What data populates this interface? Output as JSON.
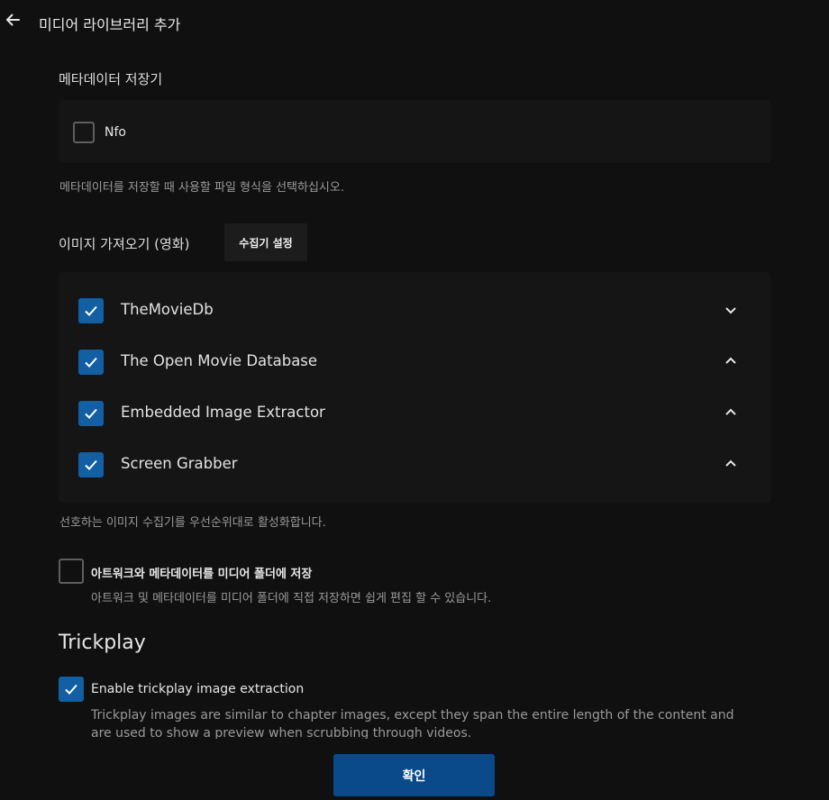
{
  "header": {
    "title": "미디어 라이브러리 추가",
    "back_icon": "arrow-left-icon"
  },
  "metadata_savers": {
    "label": "메타데이터 저장기",
    "items": [
      {
        "label": "Nfo",
        "checked": false
      }
    ],
    "help": "메타데이터를 저장할 때 사용할 파일 형식을 선택하십시오."
  },
  "image_fetchers": {
    "label": "이미지 가져오기 (영화)",
    "settings_button": "수집기 설정",
    "items": [
      {
        "label": "TheMovieDb",
        "checked": true,
        "chevron": "chevron-down-icon"
      },
      {
        "label": "The Open Movie Database",
        "checked": true,
        "chevron": "chevron-up-icon"
      },
      {
        "label": "Embedded Image Extractor",
        "checked": true,
        "chevron": "chevron-up-icon"
      },
      {
        "label": "Screen Grabber",
        "checked": true,
        "chevron": "chevron-up-icon"
      }
    ],
    "help": "선호하는 이미지 수집기를 우선순위대로 활성화합니다."
  },
  "save_local": {
    "label": "아트워크와 메타데이터를 미디어 폴더에 저장",
    "help": "아트워크 및 메타데이터를 미디어 폴더에 직접 저장하면 쉽게 편집 할 수 있습니다.",
    "checked": false
  },
  "trickplay": {
    "title": "Trickplay",
    "enable_label": "Enable trickplay image extraction",
    "enable_checked": true,
    "help": "Trickplay images are similar to chapter images, except they span the entire length of the content and are used to show a preview when scrubbing through videos."
  },
  "footer": {
    "ok_button": "확인"
  },
  "colors": {
    "accent": "#0b5394",
    "button": "#0a4a8a",
    "background": "#101010"
  }
}
